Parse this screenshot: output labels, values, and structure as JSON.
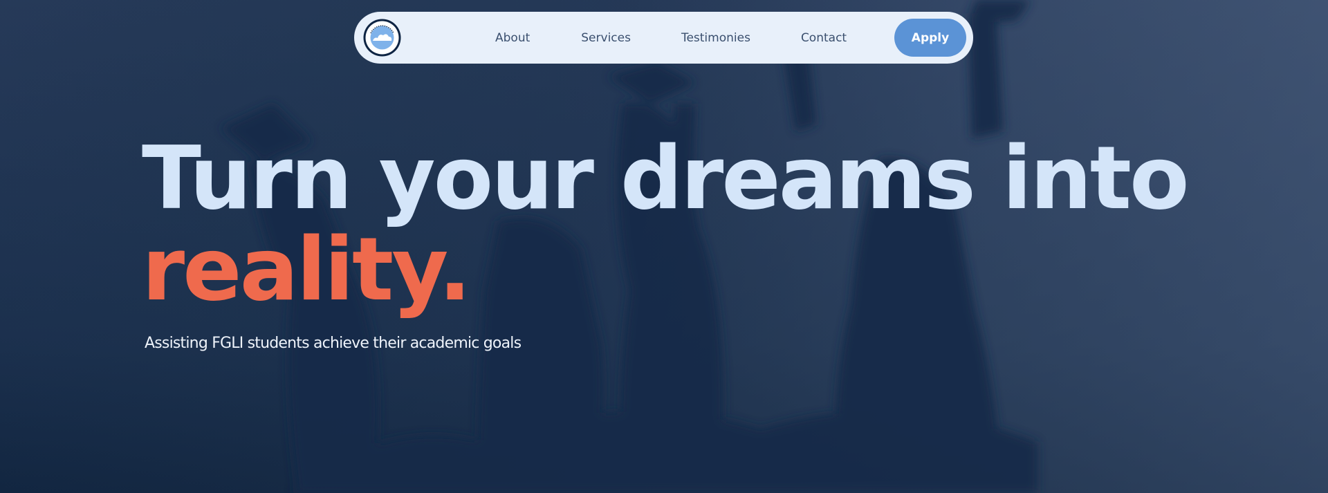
{
  "nav": {
    "logo_icon": "cloud-seal-logo",
    "links": [
      {
        "label": "About"
      },
      {
        "label": "Services"
      },
      {
        "label": "Testimonies"
      },
      {
        "label": "Contact"
      }
    ],
    "apply_label": "Apply"
  },
  "hero": {
    "headline_line1": "Turn your dreams into",
    "headline_line2": "reality.",
    "subtitle": "Assisting FGLI students achieve their academic goals"
  },
  "colors": {
    "nav_background": "#e8f0fa",
    "accent_button": "#5b93d6",
    "headline_light": "#d4e5f9",
    "headline_accent": "#ef6a4d",
    "overlay": "#1b3252"
  }
}
